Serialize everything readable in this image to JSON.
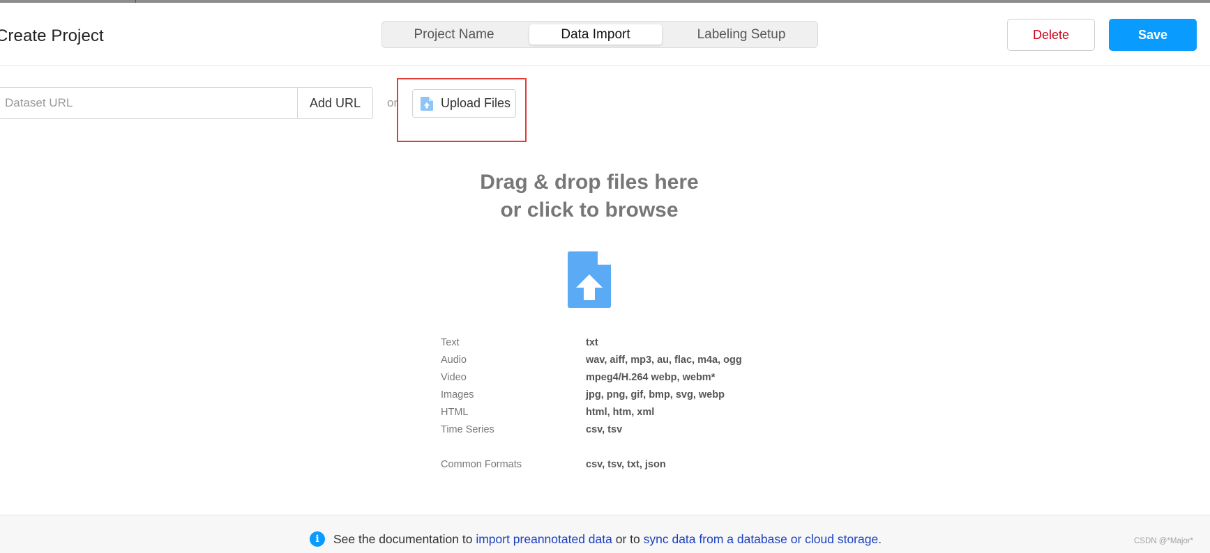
{
  "header": {
    "page_title": "Create Project",
    "tabs": [
      {
        "label": "Project Name",
        "active": false
      },
      {
        "label": "Data Import",
        "active": true
      },
      {
        "label": "Labeling Setup",
        "active": false
      }
    ],
    "delete_label": "Delete",
    "save_label": "Save"
  },
  "import": {
    "url_placeholder": "Dataset URL",
    "add_url_label": "Add URL",
    "or_label": "or",
    "upload_label": "Upload Files",
    "upload_icon": "file-upload-icon"
  },
  "dropzone": {
    "line1": "Drag & drop files here",
    "line2": "or click to browse",
    "icon": "file-upload-icon"
  },
  "formats": [
    {
      "type": "Text",
      "extensions": "txt"
    },
    {
      "type": "Audio",
      "extensions": "wav, aiff, mp3, au, flac, m4a, ogg"
    },
    {
      "type": "Video",
      "extensions": "mpeg4/H.264 webp, webm*"
    },
    {
      "type": "Images",
      "extensions": "jpg, png, gif, bmp, svg, webp"
    },
    {
      "type": "HTML",
      "extensions": "html, htm, xml"
    },
    {
      "type": "Time Series",
      "extensions": "csv, tsv"
    },
    {
      "type": "Common Formats",
      "extensions": "csv, tsv, txt, json"
    }
  ],
  "footer": {
    "info_icon": "info-icon",
    "prefix": "See the documentation to ",
    "link1": "import preannotated data",
    "middle": " or to ",
    "link2": "sync data from a database or cloud storage",
    "suffix": "."
  },
  "watermark": "CSDN @*Major*",
  "colors": {
    "primary": "#0a9bff",
    "danger": "#d0021b",
    "link": "#1a3fbf",
    "highlight": "#e53935",
    "upload_icon": "#5aaaf6"
  }
}
